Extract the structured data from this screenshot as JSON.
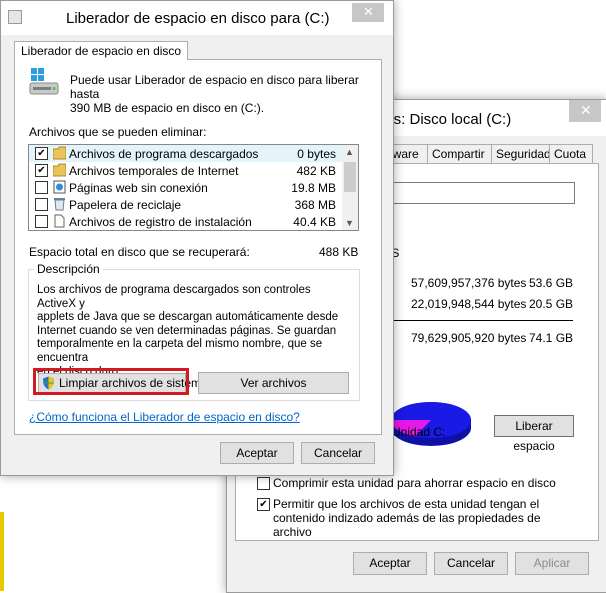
{
  "properties_window": {
    "title": "Propiedades: Disco local (C:)",
    "title_visible": "les: Disco local (C:)",
    "close_glyph": "✕",
    "tabs": [
      "rdware",
      "Compartir",
      "Seguridad",
      "Cuota"
    ],
    "fs_label": "FS",
    "used": {
      "bytes": "57,609,957,376 bytes",
      "size": "53.6 GB"
    },
    "free": {
      "bytes": "22,019,948,544 bytes",
      "size": "20.5 GB"
    },
    "capacity": {
      "bytes": "79,629,905,920 bytes",
      "size": "74.1 GB"
    },
    "drive_label": "Unidad C:",
    "free_space_button": "Liberar espacio",
    "compress_option": {
      "label": "Comprimir esta unidad para ahorrar espacio en disco",
      "checked": false
    },
    "index_option": {
      "label": "Permitir que los archivos de esta unidad tengan el contenido indizado además de las propiedades de archivo",
      "checked": true
    },
    "buttons": {
      "ok": "Aceptar",
      "cancel": "Cancelar",
      "apply": "Aplicar"
    },
    "colors": {
      "used_slice": "#1a1ae6",
      "free_slice": "#e619e6"
    }
  },
  "cleanup_window": {
    "title": "Liberador de espacio en disco para  (C:)",
    "close_glyph": "✕",
    "tab": "Liberador de espacio en disco",
    "intro_line1": "Puede usar Liberador de espacio en disco para liberar hasta",
    "intro_line2": "390 MB de espacio en disco en  (C:).",
    "files_label": "Archivos que se pueden eliminar:",
    "files": [
      {
        "name": "Archivos de programa descargados",
        "size": "0 bytes",
        "checked": true,
        "selected": true
      },
      {
        "name": "Archivos temporales de Internet",
        "size": "482 KB",
        "checked": true,
        "selected": false
      },
      {
        "name": "Páginas web sin conexión",
        "size": "19.8 MB",
        "checked": false,
        "selected": false
      },
      {
        "name": "Papelera de reciclaje",
        "size": "368 MB",
        "checked": false,
        "selected": false
      },
      {
        "name": "Archivos de registro de instalación",
        "size": "40.4 KB",
        "checked": false,
        "selected": false
      }
    ],
    "total_label": "Espacio total en disco que se recuperará:",
    "total_value": "488 KB",
    "description_legend": "Descripción",
    "description_lines": [
      "Los archivos de programa descargados son controles ActiveX y",
      "applets de Java que se descargan automáticamente desde",
      "Internet cuando se ven determinadas páginas. Se guardan",
      "temporalmente en la carpeta del mismo nombre, que se encuentra",
      "en el disco duro."
    ],
    "cleanup_system_button": "Limpiar archivos de sistema",
    "view_files_button": "Ver archivos",
    "help_link": "¿Cómo funciona el Liberador de espacio en disco?",
    "buttons": {
      "ok": "Aceptar",
      "cancel": "Cancelar"
    },
    "highlight_color": "#d21a20"
  }
}
